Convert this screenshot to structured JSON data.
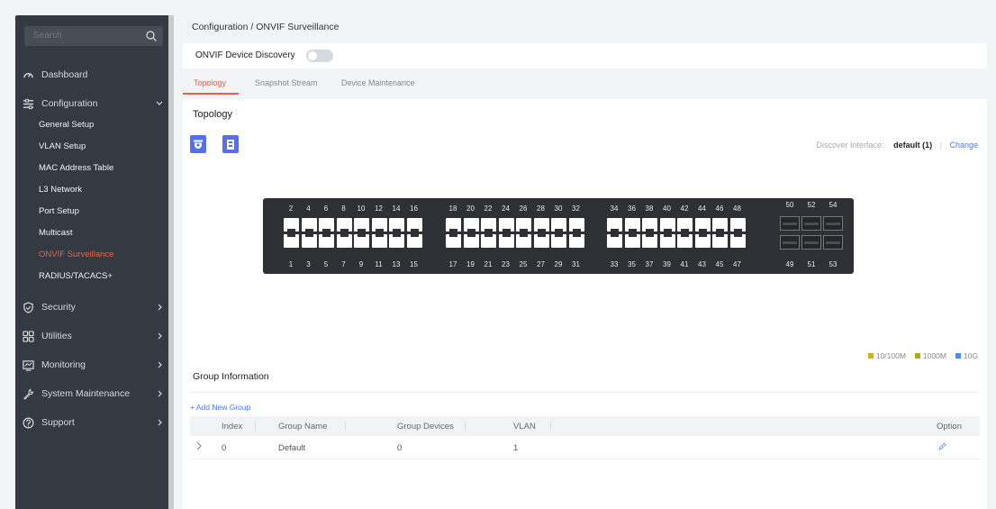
{
  "sidebar": {
    "search_placeholder": "Search",
    "top_items": [
      {
        "label": "Dashboard"
      },
      {
        "label": "Configuration"
      },
      {
        "label": "Security"
      },
      {
        "label": "Utilities"
      },
      {
        "label": "Monitoring"
      },
      {
        "label": "System Maintenance"
      },
      {
        "label": "Support"
      }
    ],
    "config_sub_items": [
      {
        "label": "General Setup"
      },
      {
        "label": "VLAN Setup"
      },
      {
        "label": "MAC Address Table"
      },
      {
        "label": "L3 Network"
      },
      {
        "label": "Port Setup"
      },
      {
        "label": "Multicast"
      },
      {
        "label": "ONVIF Surveillance"
      },
      {
        "label": "RADIUS/TACACS+"
      }
    ]
  },
  "breadcrumb": "Configuration / ONVIF Surveillance",
  "discovery": {
    "label": "ONVIF Device Discovery",
    "enabled": false
  },
  "tabs": [
    {
      "label": "Topology"
    },
    {
      "label": "Snapshot Stream"
    },
    {
      "label": "Device Maintenance"
    }
  ],
  "topology": {
    "title": "Topology",
    "discover_interface_label": "Discover Interface:",
    "discover_interface_value": "default (1)",
    "change_label": "Change"
  },
  "switch": {
    "top_labels": [
      [
        "2",
        "4",
        "6",
        "8",
        "10",
        "12",
        "14",
        "16"
      ],
      [
        "18",
        "20",
        "22",
        "24",
        "26",
        "28",
        "30",
        "32"
      ],
      [
        "34",
        "36",
        "38",
        "40",
        "42",
        "44",
        "46",
        "48"
      ]
    ],
    "bottom_labels": [
      [
        "1",
        "3",
        "5",
        "7",
        "9",
        "11",
        "13",
        "15"
      ],
      [
        "17",
        "19",
        "21",
        "23",
        "25",
        "27",
        "29",
        "31"
      ],
      [
        "33",
        "35",
        "37",
        "39",
        "41",
        "43",
        "45",
        "47"
      ]
    ],
    "sfp_top_labels": [
      "50",
      "52",
      "54"
    ],
    "sfp_bottom_labels": [
      "49",
      "51",
      "53"
    ]
  },
  "legend": [
    {
      "label": "10/100M",
      "color": "#d4b018"
    },
    {
      "label": "1000M",
      "color": "#b9a517"
    },
    {
      "label": "10G",
      "color": "#4a90f0"
    }
  ],
  "group": {
    "title": "Group Information",
    "add_label": "+ Add New Group",
    "columns": [
      "Index",
      "Group Name",
      "Group Devices",
      "VLAN",
      "Option"
    ],
    "rows": [
      {
        "index": "0",
        "name": "Default",
        "devices": "0",
        "vlan": "1"
      }
    ]
  },
  "colors": {
    "accent": "#e8604c",
    "primary_blue": "#5670e6",
    "sidebar_bg": "#333a42"
  }
}
